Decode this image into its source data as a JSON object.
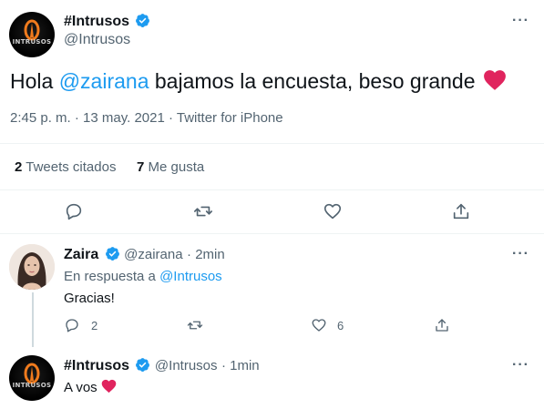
{
  "main_tweet": {
    "display_name": "#Intrusos",
    "handle": "@Intrusos",
    "avatar_logo_text": "INTRUSOS",
    "text_before": "Hola ",
    "mention": "@zairana",
    "text_after": " bajamos la encuesta, beso grande",
    "emoji": "❤️",
    "timestamp": "2:45 p. m. · 13 may. 2021 · Twitter for iPhone",
    "stats": {
      "quotes_count": "2",
      "quotes_label": "Tweets citados",
      "likes_count": "7",
      "likes_label": "Me gusta"
    }
  },
  "reply_1": {
    "display_name": "Zaira",
    "handle": "@zairana",
    "time": "· 2min",
    "reply_to_prefix": "En respuesta a ",
    "reply_to_handle": "@Intrusos",
    "text": "Gracias!",
    "reply_count": "2",
    "like_count": "6"
  },
  "reply_2": {
    "display_name": "#Intrusos",
    "handle": "@Intrusos",
    "time": "· 1min",
    "text": "A vos",
    "emoji": "❤️"
  },
  "more_glyph": "···",
  "colors": {
    "accent": "#1d9bf0",
    "heart": "#e0245e",
    "muted": "#536471",
    "divider": "#eff3f4"
  },
  "icons": [
    "verified-badge-icon",
    "reply-icon",
    "retweet-icon",
    "like-icon",
    "share-icon",
    "more-icon"
  ]
}
